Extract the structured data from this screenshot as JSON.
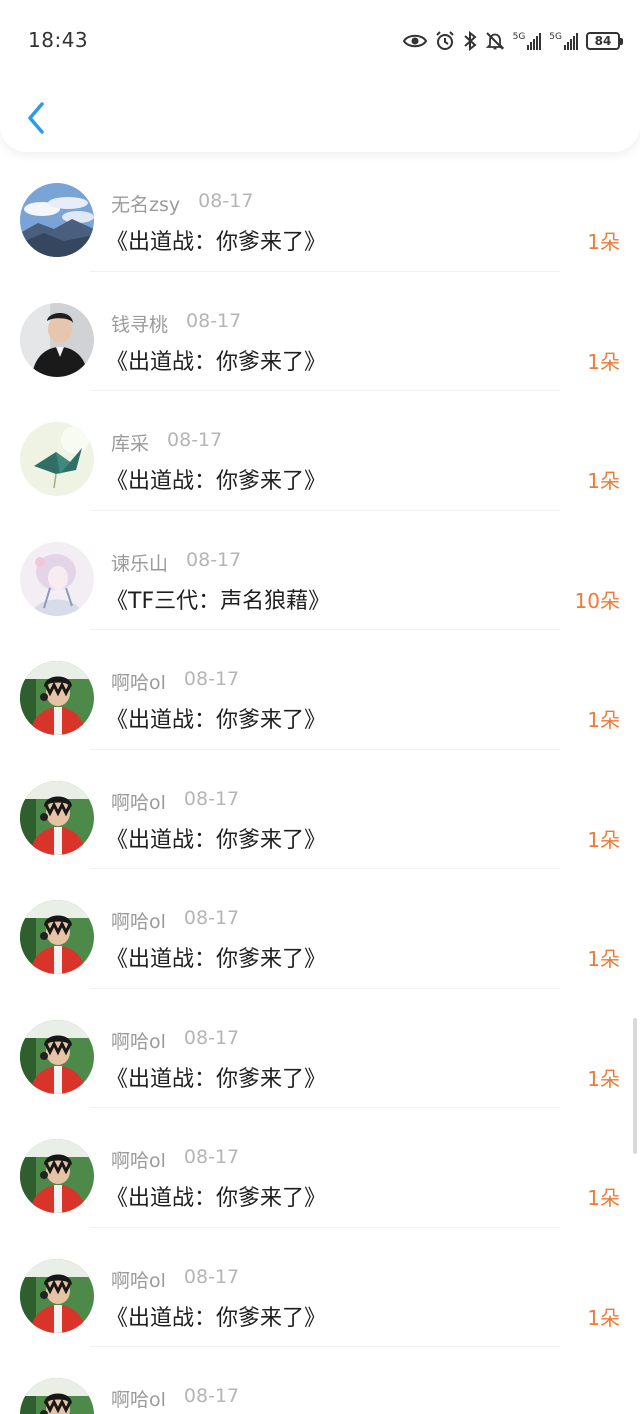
{
  "status_bar": {
    "time": "18:43",
    "battery": "84",
    "signal_label": "5G",
    "icons": [
      "eye-icon",
      "alarm-icon",
      "bluetooth-icon",
      "bell-muted-icon",
      "signal-5g-icon",
      "signal-5g-icon",
      "battery-icon"
    ]
  },
  "nav": {
    "back_icon": "chevron-left-icon",
    "accent": "#2f9be6"
  },
  "colors": {
    "count": "#f07a35",
    "name": "#9b9b9b",
    "date": "#b5b5b5",
    "title": "#1f1f1f"
  },
  "rows": [
    {
      "name": "无名zsy",
      "date": "08-17",
      "title": "《出道战：你爹来了》",
      "count": "1朵",
      "avatar": "landscape"
    },
    {
      "name": "钱寻桃",
      "date": "08-17",
      "title": "《出道战：你爹来了》",
      "count": "1朵",
      "avatar": "man-suit"
    },
    {
      "name": "库采",
      "date": "08-17",
      "title": "《出道战：你爹来了》",
      "count": "1朵",
      "avatar": "paper-crane"
    },
    {
      "name": "谏乐山",
      "date": "08-17",
      "title": "《TF三代：声名狼藉》",
      "count": "10朵",
      "avatar": "pastel-anime"
    },
    {
      "name": "啊哈ol",
      "date": "08-17",
      "title": "《出道战：你爹来了》",
      "count": "1朵",
      "avatar": "boy-red-jacket"
    },
    {
      "name": "啊哈ol",
      "date": "08-17",
      "title": "《出道战：你爹来了》",
      "count": "1朵",
      "avatar": "boy-red-jacket"
    },
    {
      "name": "啊哈ol",
      "date": "08-17",
      "title": "《出道战：你爹来了》",
      "count": "1朵",
      "avatar": "boy-red-jacket"
    },
    {
      "name": "啊哈ol",
      "date": "08-17",
      "title": "《出道战：你爹来了》",
      "count": "1朵",
      "avatar": "boy-red-jacket"
    },
    {
      "name": "啊哈ol",
      "date": "08-17",
      "title": "《出道战：你爹来了》",
      "count": "1朵",
      "avatar": "boy-red-jacket"
    },
    {
      "name": "啊哈ol",
      "date": "08-17",
      "title": "《出道战：你爹来了》",
      "count": "1朵",
      "avatar": "boy-red-jacket"
    },
    {
      "name": "啊哈ol",
      "date": "08-17",
      "title": "",
      "count": "",
      "avatar": "boy-red-jacket"
    }
  ]
}
